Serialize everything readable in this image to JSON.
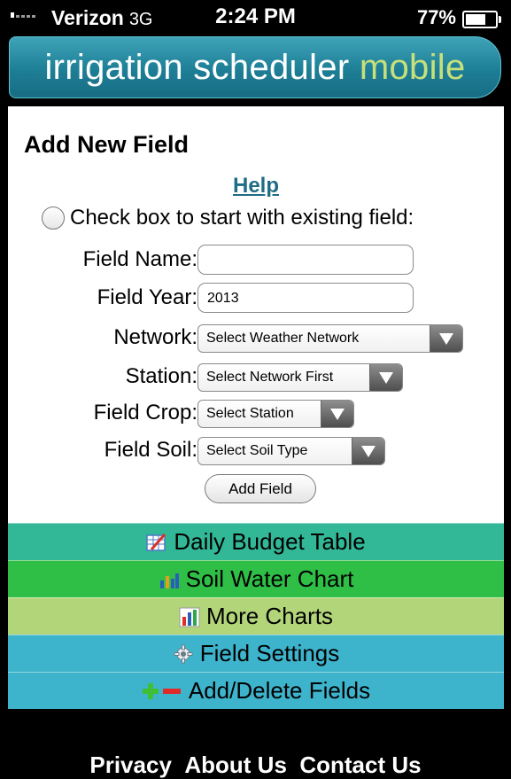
{
  "status_bar": {
    "carrier": "Verizon",
    "network": "3G",
    "time": "2:24 PM",
    "battery_percent": "77%",
    "battery_level": 0.77
  },
  "header": {
    "logo_main": "irrigation scheduler ",
    "logo_accent": "mobile"
  },
  "form": {
    "title": "Add New Field",
    "help_link": "Help",
    "existing_checkbox_label": "Check box to start with existing field:",
    "existing_checked": false,
    "field_name": {
      "label": "Field Name:",
      "value": ""
    },
    "field_year": {
      "label": "Field Year:",
      "value": "2013"
    },
    "network": {
      "label": "Network:",
      "selected": "Select Weather Network"
    },
    "station": {
      "label": "Station:",
      "selected": "Select Network First"
    },
    "crop": {
      "label": "Field Crop:",
      "selected": "Select Station"
    },
    "soil": {
      "label": "Field Soil:",
      "selected": "Select Soil Type"
    },
    "submit_label": "Add Field"
  },
  "menu": {
    "items": [
      {
        "label": "Daily Budget Table",
        "icon": "table-icon",
        "color": "#33b897"
      },
      {
        "label": "Soil Water Chart",
        "icon": "bar-chart-icon",
        "color": "#2fbf47"
      },
      {
        "label": "More Charts",
        "icon": "charts-icon",
        "color": "#b2d57a"
      },
      {
        "label": "Field Settings",
        "icon": "gear-icon",
        "color": "#3eb4cc"
      },
      {
        "label": "Add/Delete Fields",
        "icon": "plus-minus-icon",
        "color": "#3eb4cc"
      }
    ]
  },
  "footer": {
    "privacy": "Privacy",
    "about": "About Us",
    "contact": "Contact Us"
  }
}
